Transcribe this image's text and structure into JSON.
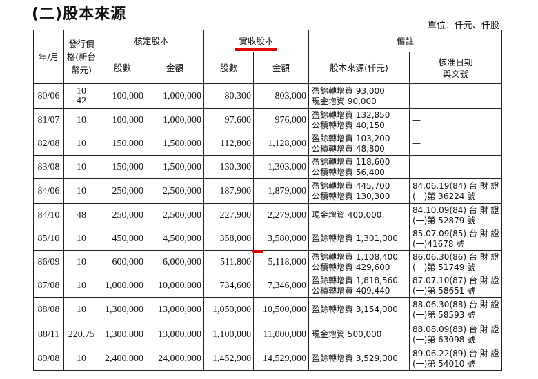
{
  "section_title": "(二)股本來源",
  "unit_label": "單位：仟元、仟股",
  "headers": {
    "year_month": "年/月",
    "issue_price": "發行價格(新台幣元)",
    "authorized": "核定股本",
    "paid_in": "實收股本",
    "remarks": "備註",
    "shares": "股數",
    "amount": "金額",
    "source": "股本來源(仟元)",
    "approval": "核准日期與文號"
  },
  "rows": [
    {
      "ym": "80/06",
      "price": "10\n42",
      "auth_shares": "100,000",
      "auth_amount": "1,000,000",
      "paid_shares": "80,300",
      "paid_amount": "803,000",
      "source": [
        "盈餘轉增資 93,000",
        "現金增資 90,000"
      ],
      "approval": [
        "—"
      ]
    },
    {
      "ym": "81/07",
      "price": "10",
      "auth_shares": "100,000",
      "auth_amount": "1,000,000",
      "paid_shares": "97,600",
      "paid_amount": "976,000",
      "source": [
        "盈餘轉增資 132,850",
        "公積轉增資 40,150"
      ],
      "approval": [
        "—"
      ]
    },
    {
      "ym": "82/08",
      "price": "10",
      "auth_shares": "150,000",
      "auth_amount": "1,500,000",
      "paid_shares": "112,800",
      "paid_amount": "1,128,000",
      "source": [
        "盈餘轉增資 103,200",
        "公積轉增資 48,800"
      ],
      "approval": [
        "—"
      ]
    },
    {
      "ym": "83/08",
      "price": "10",
      "auth_shares": "150,000",
      "auth_amount": "1,500,000",
      "paid_shares": "130,300",
      "paid_amount": "1,303,000",
      "source": [
        "盈餘轉增資 118,600",
        "公積轉增資 56,400"
      ],
      "approval": [
        "—"
      ]
    },
    {
      "ym": "84/06",
      "price": "10",
      "auth_shares": "250,000",
      "auth_amount": "2,500,000",
      "paid_shares": "187,900",
      "paid_amount": "1,879,000",
      "source": [
        "盈餘轉增資 445,700",
        "公積轉增資 130,300"
      ],
      "approval": [
        "84.06.19(84) 台 財 證",
        "(一)第 36224 號"
      ]
    },
    {
      "ym": "84/10",
      "price": "48",
      "auth_shares": "250,000",
      "auth_amount": "2,500,000",
      "paid_shares": "227,900",
      "paid_amount": "2,279,000",
      "source": [
        "現金增資 400,000"
      ],
      "approval": [
        "84.10.09(84) 台 財 證",
        "(一)第 52879 號"
      ]
    },
    {
      "ym": "85/10",
      "price": "10",
      "auth_shares": "450,000",
      "auth_amount": "4,500,000",
      "paid_shares": "358,000",
      "paid_amount": "3,580,000",
      "source": [
        "盈餘轉增資 1,301,000"
      ],
      "approval": [
        "85.07.09(85) 台 財 證",
        "(一)41678 號"
      ]
    },
    {
      "ym": "86/09",
      "price": "10",
      "auth_shares": "600,000",
      "auth_amount": "6,000,000",
      "paid_shares": "511,800",
      "paid_amount": "5,118,000",
      "source": [
        "盈餘轉增資 1,108,400",
        "公積轉增資 429,600"
      ],
      "approval": [
        "86.06.30(86) 台 財 證",
        "(一)第 51749 號"
      ]
    },
    {
      "ym": "87/08",
      "price": "10",
      "auth_shares": "1,000,000",
      "auth_amount": "10,000,000",
      "paid_shares": "734,600",
      "paid_amount": "7,346,000",
      "source": [
        "盈餘轉增資 1,818,560",
        "公積轉增資 409,440"
      ],
      "approval": [
        "87.07.10(87) 台 財 證",
        "(一)第 58651 號"
      ]
    },
    {
      "ym": "88/08",
      "price": "10",
      "auth_shares": "1,300,000",
      "auth_amount": "13,000,000",
      "paid_shares": "1,050,000",
      "paid_amount": "10,500,000",
      "source": [
        "盈餘轉增資 3,154,000"
      ],
      "approval": [
        "88.06.30(88) 台 財 證",
        "(一)第 58593 號"
      ]
    },
    {
      "ym": "88/11",
      "price": "220.75",
      "auth_shares": "1,300,000",
      "auth_amount": "13,000,000",
      "paid_shares": "1,100,000",
      "paid_amount": "11,000,000",
      "source": [
        "現金增資 500,000"
      ],
      "approval": [
        "88.08.09(88) 台 財 證",
        "(一)第 63098 號"
      ]
    },
    {
      "ym": "89/08",
      "price": "10",
      "auth_shares": "2,400,000",
      "auth_amount": "24,000,000",
      "paid_shares": "1,452,900",
      "paid_amount": "14,529,000",
      "source": [
        "盈餘轉增資 3,529,000"
      ],
      "approval": [
        "89.06.22(89) 台 財 證",
        "(一)第 54010 號"
      ]
    }
  ],
  "annotation_color": "#e00000"
}
